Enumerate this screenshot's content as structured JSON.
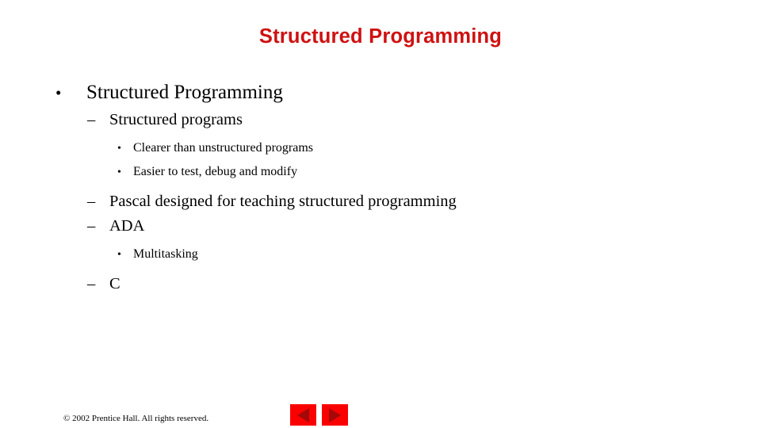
{
  "slide": {
    "title": "Structured Programming",
    "title_color": "#cf1111",
    "background_color": "#ffffff",
    "outline": [
      {
        "level": 1,
        "marker": "•",
        "text": "Structured Programming"
      },
      {
        "level": 2,
        "marker": "–",
        "text": "Structured programs"
      },
      {
        "level": 3,
        "marker": "•",
        "text": "Clearer than unstructured programs"
      },
      {
        "level": 3,
        "marker": "•",
        "text": "Easier to test, debug and modify"
      },
      {
        "level": 2,
        "marker": "–",
        "text": "Pascal designed for teaching structured programming"
      },
      {
        "level": 2,
        "marker": "–",
        "text": "ADA"
      },
      {
        "level": 3,
        "marker": "•",
        "text": "Multitasking"
      },
      {
        "level": 2,
        "marker": "–",
        "text": "C"
      }
    ]
  },
  "footer": {
    "copyright": "© 2002 Prentice Hall.  All rights reserved.",
    "nav": {
      "previous_label": "◀",
      "next_label": "▶",
      "button_color": "#fb0000",
      "arrow_color": "#a50808"
    }
  }
}
